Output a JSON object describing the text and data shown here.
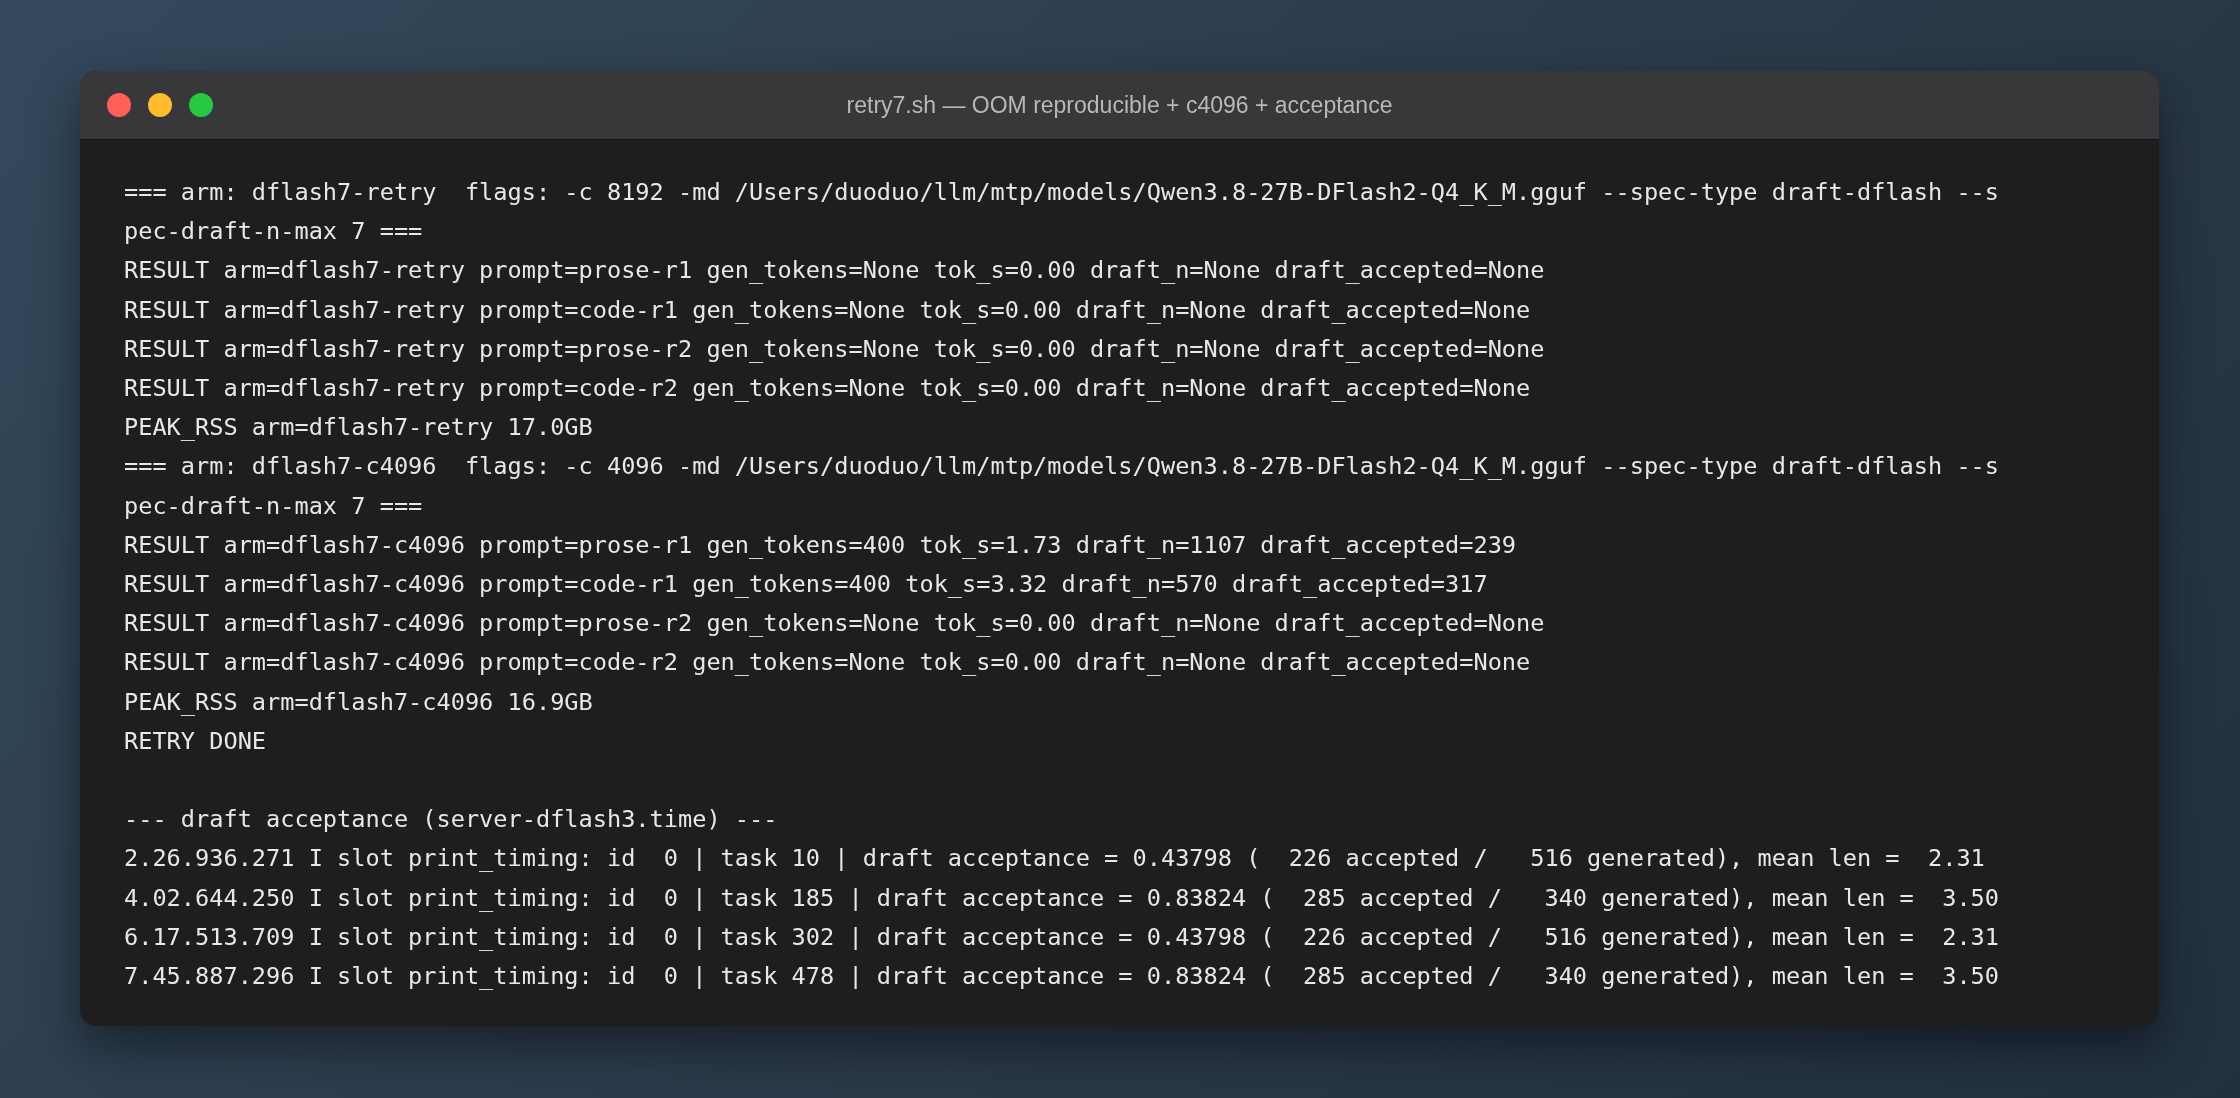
{
  "window": {
    "title": "retry7.sh — OOM reproducible + c4096 + acceptance"
  },
  "blocks": [
    {
      "lines": [
        "=== arm: dflash7-retry  flags: -c 8192 -md /Users/duoduo/llm/mtp/models/Qwen3.8-27B-DFlash2-Q4_K_M.gguf --spec-type draft-dflash --s",
        "pec-draft-n-max 7 ===",
        "RESULT arm=dflash7-retry prompt=prose-r1 gen_tokens=None tok_s=0.00 draft_n=None draft_accepted=None",
        "RESULT arm=dflash7-retry prompt=code-r1 gen_tokens=None tok_s=0.00 draft_n=None draft_accepted=None",
        "RESULT arm=dflash7-retry prompt=prose-r2 gen_tokens=None tok_s=0.00 draft_n=None draft_accepted=None",
        "RESULT arm=dflash7-retry prompt=code-r2 gen_tokens=None tok_s=0.00 draft_n=None draft_accepted=None",
        "PEAK_RSS arm=dflash7-retry 17.0GB",
        "=== arm: dflash7-c4096  flags: -c 4096 -md /Users/duoduo/llm/mtp/models/Qwen3.8-27B-DFlash2-Q4_K_M.gguf --spec-type draft-dflash --s",
        "pec-draft-n-max 7 ===",
        "RESULT arm=dflash7-c4096 prompt=prose-r1 gen_tokens=400 tok_s=1.73 draft_n=1107 draft_accepted=239",
        "RESULT arm=dflash7-c4096 prompt=code-r1 gen_tokens=400 tok_s=3.32 draft_n=570 draft_accepted=317",
        "RESULT arm=dflash7-c4096 prompt=prose-r2 gen_tokens=None tok_s=0.00 draft_n=None draft_accepted=None",
        "RESULT arm=dflash7-c4096 prompt=code-r2 gen_tokens=None tok_s=0.00 draft_n=None draft_accepted=None",
        "PEAK_RSS arm=dflash7-c4096 16.9GB",
        "RETRY DONE"
      ]
    },
    {
      "lines": [
        "--- draft acceptance (server-dflash3.time) ---",
        "2.26.936.271 I slot print_timing: id  0 | task 10 | draft acceptance = 0.43798 (  226 accepted /   516 generated), mean len =  2.31",
        "4.02.644.250 I slot print_timing: id  0 | task 185 | draft acceptance = 0.83824 (  285 accepted /   340 generated), mean len =  3.50",
        "6.17.513.709 I slot print_timing: id  0 | task 302 | draft acceptance = 0.43798 (  226 accepted /   516 generated), mean len =  2.31",
        "7.45.887.296 I slot print_timing: id  0 | task 478 | draft acceptance = 0.83824 (  285 accepted /   340 generated), mean len =  3.50"
      ]
    }
  ]
}
